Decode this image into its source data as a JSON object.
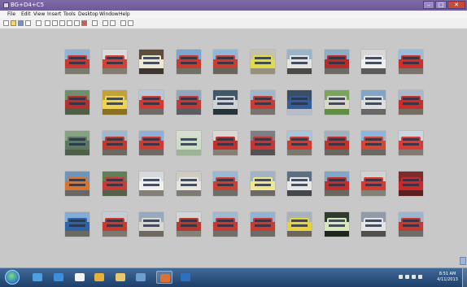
{
  "window": {
    "title": "BG+D4+C5",
    "controls": [
      "–",
      "□",
      "✕"
    ]
  },
  "menu": [
    "File",
    "Edit",
    "View",
    "Insert",
    "Tools",
    "Desktop",
    "Window",
    "Help"
  ],
  "toolbar": [
    "new-figure",
    "open-file",
    "save",
    "print",
    "select",
    "zoom-in",
    "zoom-out",
    "pan",
    "rotate-3d",
    "data-cursor",
    "brush",
    "link",
    "colorbar",
    "legend",
    "plot-browser",
    "property-editor"
  ],
  "figure": {
    "grid_rows": 5,
    "grid_cols": 10,
    "thumbnails": [
      {
        "sky": "#8db3d6",
        "body": "#c9372e",
        "ground": "#7a7a6f"
      },
      {
        "sky": "#d8dbe0",
        "body": "#d34235",
        "ground": "#827c73"
      },
      {
        "sky": "#5f4d3b",
        "body": "#ede8d2",
        "ground": "#3d3530"
      },
      {
        "sky": "#76a7d5",
        "body": "#c83b2d",
        "ground": "#717168"
      },
      {
        "sky": "#90b7dc",
        "body": "#c54032",
        "ground": "#67665d"
      },
      {
        "sky": "#c6c1b1",
        "body": "#e0db4b",
        "ground": "#95917d"
      },
      {
        "sky": "#99b5cc",
        "body": "#e4e4e2",
        "ground": "#4b4a47"
      },
      {
        "sky": "#8aaeca",
        "body": "#b82c27",
        "ground": "#6d6a65"
      },
      {
        "sky": "#d6d6d6",
        "body": "#efefef",
        "ground": "#5b5b5b"
      },
      {
        "sky": "#96bfdf",
        "body": "#cf2f2c",
        "ground": "#7a756c"
      },
      {
        "sky": "#6f8e6b",
        "body": "#b5312d",
        "ground": "#4f5e45"
      },
      {
        "sky": "#c2a13d",
        "body": "#f0d44f",
        "ground": "#8a7120"
      },
      {
        "sky": "#b5c7d8",
        "body": "#d5382f",
        "ground": "#6f6c68"
      },
      {
        "sky": "#8fa8c0",
        "body": "#c03b34",
        "ground": "#5b5d62"
      },
      {
        "sky": "#415868",
        "body": "#cfd2d4",
        "ground": "#28323a"
      },
      {
        "sky": "#9fb7ca",
        "body": "#c83c31",
        "ground": "#77736d"
      },
      {
        "sky": "#3a4f64",
        "body": "#365c97",
        "ground": "#b7beca"
      },
      {
        "sky": "#78a55b",
        "body": "#dbd7c8",
        "ground": "#5f8d45"
      },
      {
        "sky": "#81a5c5",
        "body": "#dedede",
        "ground": "#676767"
      },
      {
        "sky": "#a8b9c9",
        "body": "#c92f28",
        "ground": "#756d61"
      },
      {
        "sky": "#86a381",
        "body": "#5a7960",
        "ground": "#4f5f49"
      },
      {
        "sky": "#9eb8d2",
        "body": "#c13b2d",
        "ground": "#6b6961"
      },
      {
        "sky": "#8eb1d8",
        "body": "#d03b31",
        "ground": "#6f6b64"
      },
      {
        "sky": "#d5decf",
        "body": "#c8ddc4",
        "ground": "#9db497"
      },
      {
        "sky": "#d9d8d5",
        "body": "#c1302a",
        "ground": "#857f77"
      },
      {
        "sky": "#7d7f82",
        "body": "#c63532",
        "ground": "#535151"
      },
      {
        "sky": "#a8c5de",
        "body": "#d23c30",
        "ground": "#7a7870"
      },
      {
        "sky": "#9fb0c0",
        "body": "#c23229",
        "ground": "#6a6761"
      },
      {
        "sky": "#8cb5dd",
        "body": "#d44532",
        "ground": "#6b6963"
      },
      {
        "sky": "#c9d6e1",
        "body": "#d93c36",
        "ground": "#827b73"
      },
      {
        "sky": "#6d96bf",
        "body": "#d9742f",
        "ground": "#6a6663"
      },
      {
        "sky": "#5f7f59",
        "body": "#c83c34",
        "ground": "#566149"
      },
      {
        "sky": "#d5d9db",
        "body": "#f0f0ee",
        "ground": "#857f79"
      },
      {
        "sky": "#cfcbc3",
        "body": "#e8e6df",
        "ground": "#7d7a74"
      },
      {
        "sky": "#98b8d8",
        "body": "#c64033",
        "ground": "#6f6e68"
      },
      {
        "sky": "#a1b3c8",
        "body": "#efe78e",
        "ground": "#6d6a64"
      },
      {
        "sky": "#5d6f85",
        "body": "#e7e7e5",
        "ground": "#46464d"
      },
      {
        "sky": "#7fa7cb",
        "body": "#c22f2b",
        "ground": "#6b675f"
      },
      {
        "sky": "#cfd3d1",
        "body": "#d23b31",
        "ground": "#858176"
      },
      {
        "sky": "#7e2b2b",
        "body": "#c9292a",
        "ground": "#5d1f1f"
      },
      {
        "sky": "#84abd3",
        "body": "#2b64a8",
        "ground": "#6a6a62"
      },
      {
        "sky": "#c4ccd6",
        "body": "#c83a2c",
        "ground": "#7d7870"
      },
      {
        "sky": "#95aac2",
        "body": "#d9d6cf",
        "ground": "#6e6960"
      },
      {
        "sky": "#d2d6d6",
        "body": "#b73a2f",
        "ground": "#858078"
      },
      {
        "sky": "#9ebad3",
        "body": "#c73a31",
        "ground": "#726f6a"
      },
      {
        "sky": "#8fb4d6",
        "body": "#c83b31",
        "ground": "#6e6c65"
      },
      {
        "sky": "#a6b4c0",
        "body": "#e6d23e",
        "ground": "#6a6659"
      },
      {
        "sky": "#2e3b2e",
        "body": "#d9e8b8",
        "ground": "#1f261f"
      },
      {
        "sky": "#8f9ba8",
        "body": "#e4e4e6",
        "ground": "#514f4d"
      },
      {
        "sky": "#9ab7d2",
        "body": "#c33a30",
        "ground": "#6f6d67"
      }
    ]
  },
  "taskbar": {
    "apps": [
      {
        "name": "media-center-icon",
        "color": "#4fa0e0"
      },
      {
        "name": "internet-explorer-icon",
        "color": "#3b8fde"
      },
      {
        "name": "document-icon",
        "color": "#f4f4f4"
      },
      {
        "name": "chrome-icon",
        "color": "#e8b23a"
      },
      {
        "name": "file-explorer-icon",
        "color": "#e7c96b"
      },
      {
        "name": "media-player-icon",
        "color": "#6d9ecf"
      },
      {
        "name": "matlab-icon",
        "color": "#e07030"
      },
      {
        "name": "word-icon",
        "color": "#2f6fbf"
      }
    ],
    "clock_time": "8:51 AM",
    "clock_date": "4/11/2013"
  },
  "colors": {
    "figure_bg": "#c8c8c8",
    "titlebar": "#7563a0",
    "taskbar": "#2c4f7c"
  }
}
